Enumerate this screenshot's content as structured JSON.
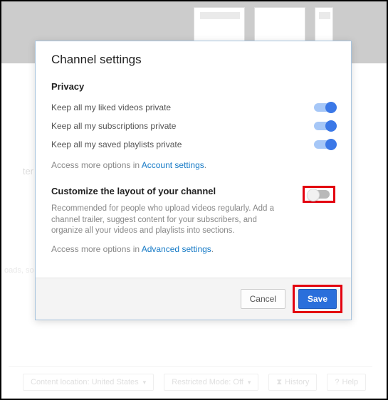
{
  "bg": {
    "left_text": "ter",
    "prompt": "oads, so t"
  },
  "modal": {
    "title": "Channel settings",
    "privacy": {
      "label": "Privacy",
      "opts": [
        {
          "label": "Keep all my liked videos private",
          "on": true
        },
        {
          "label": "Keep all my subscriptions private",
          "on": true
        },
        {
          "label": "Keep all my saved playlists private",
          "on": true
        }
      ],
      "note_prefix": "Access more options in ",
      "note_link": "Account settings",
      "note_suffix": "."
    },
    "customize": {
      "label": "Customize the layout of your channel",
      "on": false,
      "desc": "Recommended for people who upload videos regularly. Add a channel trailer, suggest content for your subscribers, and organize all your videos and playlists into sections.",
      "note_prefix": "Access more options in ",
      "note_link": "Advanced settings",
      "note_suffix": "."
    },
    "footer": {
      "cancel": "Cancel",
      "save": "Save"
    }
  },
  "footer_bar": {
    "location": "Content location: United States",
    "restricted": "Restricted Mode: Off",
    "history": "History",
    "help": "Help"
  }
}
